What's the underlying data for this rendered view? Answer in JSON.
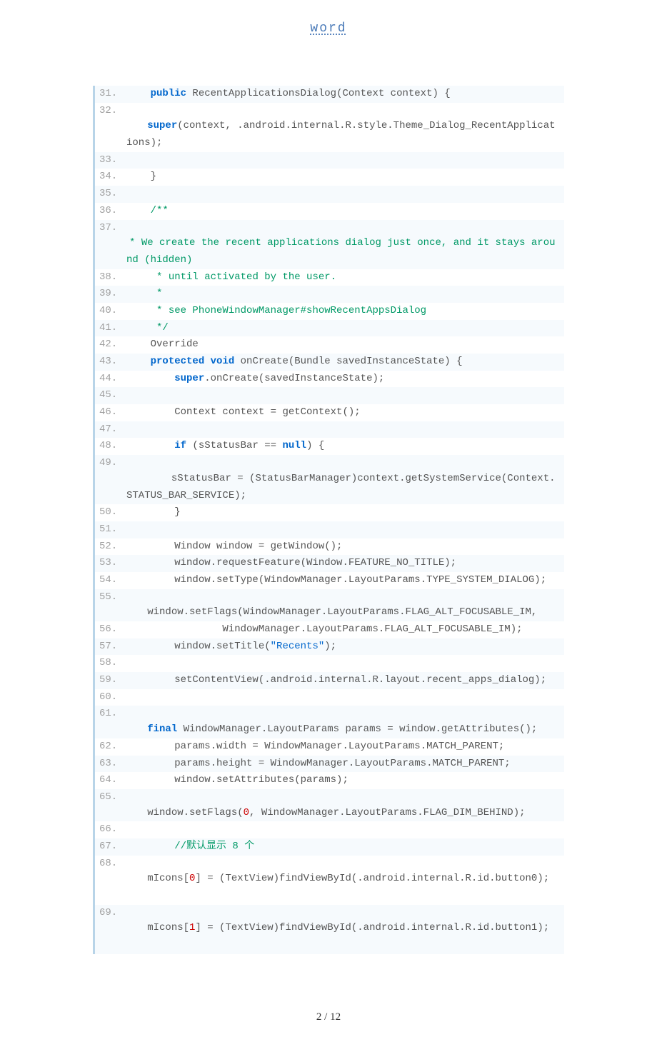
{
  "header": {
    "title": "word"
  },
  "footer": {
    "page": "2",
    "sep": " / ",
    "total": "12"
  },
  "code": {
    "lines": [
      {
        "n": "31.",
        "alt": true,
        "segs": [
          {
            "t": "    "
          },
          {
            "t": "public",
            "c": "kw"
          },
          {
            "t": " RecentApplicationsDialog(Context context) {  "
          }
        ]
      },
      {
        "n": "32.",
        "alt": false,
        "segs": [
          {
            "t": "        "
          },
          {
            "t": "super",
            "c": "kw"
          },
          {
            "t": "(context, .android.internal.R.style.Theme_Dialog_RecentApplicat"
          }
        ],
        "wrap": [
          {
            "t": "ions);  "
          }
        ]
      },
      {
        "n": "33.",
        "alt": true,
        "segs": [
          {
            "t": "  "
          }
        ]
      },
      {
        "n": "34.",
        "alt": false,
        "segs": [
          {
            "t": "    }  "
          }
        ]
      },
      {
        "n": "35.",
        "alt": true,
        "segs": [
          {
            "t": "  "
          }
        ]
      },
      {
        "n": "36.",
        "alt": false,
        "segs": [
          {
            "t": "    "
          },
          {
            "t": "/** ",
            "c": "cm"
          }
        ]
      },
      {
        "n": "37.",
        "alt": true,
        "segs": [
          {
            "t": "     * We create the recent applications dialog just once, and it stays arou",
            "c": "cm"
          }
        ],
        "wrap": [
          {
            "t": "nd (hidden) ",
            "c": "cm"
          }
        ]
      },
      {
        "n": "38.",
        "alt": false,
        "segs": [
          {
            "t": "     * until activated by the user. ",
            "c": "cm"
          }
        ]
      },
      {
        "n": "39.",
        "alt": true,
        "segs": [
          {
            "t": "     *  ",
            "c": "cm"
          }
        ]
      },
      {
        "n": "40.",
        "alt": false,
        "segs": [
          {
            "t": "     * see PhoneWindowManager#showRecentAppsDialog ",
            "c": "cm"
          }
        ]
      },
      {
        "n": "41.",
        "alt": true,
        "segs": [
          {
            "t": "     */",
            "c": "cm"
          },
          {
            "t": "  "
          }
        ]
      },
      {
        "n": "42.",
        "alt": false,
        "segs": [
          {
            "t": "    Override  "
          }
        ]
      },
      {
        "n": "43.",
        "alt": true,
        "segs": [
          {
            "t": "    "
          },
          {
            "t": "protected",
            "c": "kw"
          },
          {
            "t": " "
          },
          {
            "t": "void",
            "c": "kw"
          },
          {
            "t": " onCreate(Bundle savedInstanceState) {  "
          }
        ]
      },
      {
        "n": "44.",
        "alt": false,
        "segs": [
          {
            "t": "        "
          },
          {
            "t": "super",
            "c": "kw"
          },
          {
            "t": ".onCreate(savedInstanceState);  "
          }
        ]
      },
      {
        "n": "45.",
        "alt": true,
        "segs": [
          {
            "t": "  "
          }
        ]
      },
      {
        "n": "46.",
        "alt": false,
        "segs": [
          {
            "t": "        Context context = getContext();  "
          }
        ]
      },
      {
        "n": "47.",
        "alt": true,
        "segs": [
          {
            "t": "  "
          }
        ]
      },
      {
        "n": "48.",
        "alt": false,
        "segs": [
          {
            "t": "        "
          },
          {
            "t": "if",
            "c": "kw"
          },
          {
            "t": " (sStatusBar == "
          },
          {
            "t": "null",
            "c": "kw"
          },
          {
            "t": ") {  "
          }
        ]
      },
      {
        "n": "49.",
        "alt": true,
        "segs": [
          {
            "t": "            sStatusBar = (StatusBarManager)context.getSystemService(Context."
          }
        ],
        "wrap": [
          {
            "t": "STATUS_BAR_SERVICE);  "
          }
        ]
      },
      {
        "n": "50.",
        "alt": false,
        "segs": [
          {
            "t": "        }  "
          }
        ]
      },
      {
        "n": "51.",
        "alt": true,
        "segs": [
          {
            "t": "  "
          }
        ]
      },
      {
        "n": "52.",
        "alt": false,
        "segs": [
          {
            "t": "        Window window = getWindow();  "
          }
        ]
      },
      {
        "n": "53.",
        "alt": true,
        "segs": [
          {
            "t": "        window.requestFeature(Window.FEATURE_NO_TITLE);  "
          }
        ]
      },
      {
        "n": "54.",
        "alt": false,
        "segs": [
          {
            "t": "        window.setType(WindowManager.LayoutParams.TYPE_SYSTEM_DIALOG);  "
          }
        ]
      },
      {
        "n": "55.",
        "alt": true,
        "segs": [
          {
            "t": "        window.setFlags(WindowManager.LayoutParams.FLAG_ALT_FOCUSABLE_IM,  "
          }
        ]
      },
      {
        "n": "56.",
        "alt": false,
        "segs": [
          {
            "t": "                WindowManager.LayoutParams.FLAG_ALT_FOCUSABLE_IM);  "
          }
        ]
      },
      {
        "n": "57.",
        "alt": true,
        "segs": [
          {
            "t": "        window.setTitle("
          },
          {
            "t": "\"Recents\"",
            "c": "str"
          },
          {
            "t": ");  "
          }
        ]
      },
      {
        "n": "58.",
        "alt": false,
        "segs": [
          {
            "t": "  "
          }
        ]
      },
      {
        "n": "59.",
        "alt": true,
        "segs": [
          {
            "t": "        setContentView(.android.internal.R.layout.recent_apps_dialog);  "
          }
        ]
      },
      {
        "n": "60.",
        "alt": false,
        "segs": [
          {
            "t": "  "
          }
        ]
      },
      {
        "n": "61.",
        "alt": true,
        "segs": [
          {
            "t": "        "
          },
          {
            "t": "final",
            "c": "kw"
          },
          {
            "t": " WindowManager.LayoutParams params = window.getAttributes();  "
          }
        ]
      },
      {
        "n": "62.",
        "alt": false,
        "segs": [
          {
            "t": "        params.width = WindowManager.LayoutParams.MATCH_PARENT;  "
          }
        ]
      },
      {
        "n": "63.",
        "alt": true,
        "segs": [
          {
            "t": "        params.height = WindowManager.LayoutParams.MATCH_PARENT;  "
          }
        ]
      },
      {
        "n": "64.",
        "alt": false,
        "segs": [
          {
            "t": "        window.setAttributes(params);  "
          }
        ]
      },
      {
        "n": "65.",
        "alt": true,
        "segs": [
          {
            "t": "        window.setFlags("
          },
          {
            "t": "0",
            "c": "num"
          },
          {
            "t": ", WindowManager.LayoutParams.FLAG_DIM_BEHIND);  "
          }
        ]
      },
      {
        "n": "66.",
        "alt": false,
        "segs": [
          {
            "t": "  "
          }
        ]
      },
      {
        "n": "67.",
        "alt": true,
        "segs": [
          {
            "t": "        "
          },
          {
            "t": "//默认显示 8 个  ",
            "c": "cm"
          }
        ]
      },
      {
        "n": "68.",
        "alt": false,
        "segs": [
          {
            "t": "        mIcons["
          },
          {
            "t": "0",
            "c": "num"
          },
          {
            "t": "] = (TextView)findViewById(.android.internal.R.id.button0);"
          }
        ],
        "wrap": [
          {
            "t": "  "
          }
        ]
      },
      {
        "n": "69.",
        "alt": true,
        "segs": [
          {
            "t": "        mIcons["
          },
          {
            "t": "1",
            "c": "num"
          },
          {
            "t": "] = (TextView)findViewById(.android.internal.R.id.button1);"
          }
        ],
        "wrap": [
          {
            "t": "  "
          }
        ]
      }
    ]
  }
}
